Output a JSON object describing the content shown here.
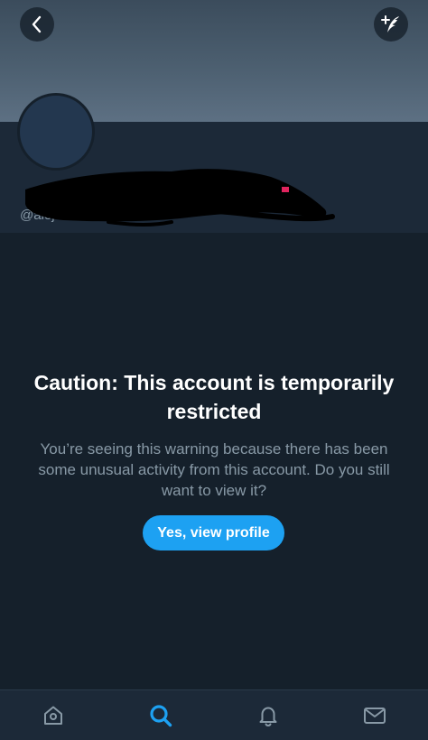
{
  "profile": {
    "name": "",
    "handle": "@alej"
  },
  "warning": {
    "title": "Caution: This account is temporarily restricted",
    "body": "You’re seeing this warning because there has been some unusual activity from this account. Do you still want to view it?",
    "button_label": "Yes, view profile"
  },
  "icons": {
    "back": "chevron-left-icon",
    "compose": "compose-tweet-icon",
    "home": "home-icon",
    "search": "search-icon",
    "notifications": "bell-icon",
    "messages": "mail-icon"
  },
  "colors": {
    "background": "#15202b",
    "panel": "#1c2938",
    "accent": "#1da1f2",
    "secondary_text": "#8899a6"
  },
  "nav": {
    "active": "search"
  }
}
